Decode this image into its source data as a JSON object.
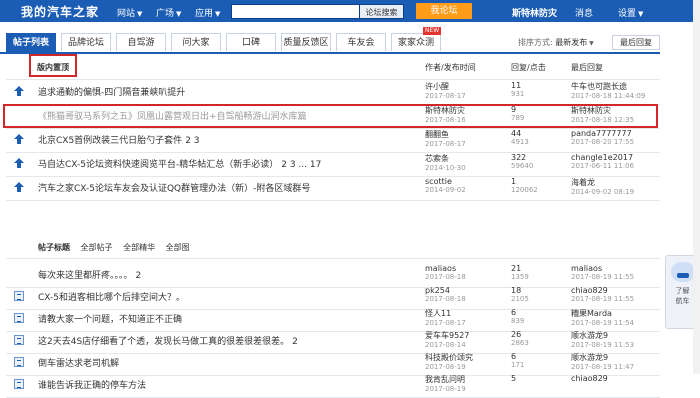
{
  "topbar": {
    "logo": "我的汽车之家",
    "nav": [
      "网站",
      "广场",
      "应用"
    ],
    "search_button": "论坛搜索",
    "post_button": "我论坛",
    "username": "斯特林防灾",
    "messages": "消息",
    "settings": "设置"
  },
  "tabs": [
    "帖子列表",
    "品牌论坛",
    "自驾游",
    "问大家",
    "口碑",
    "质量反馈区",
    "车友会",
    "家家众测"
  ],
  "new_badge": "NEW",
  "sort": {
    "label": "排序方式:",
    "value": "最新发布"
  },
  "latest_reply_button": "最后回复",
  "header": {
    "pinned_label": "版内置顶",
    "author_col": "作者/发布时间",
    "reply_col": "回复/点击",
    "last_reply_col": "最后回复"
  },
  "pinned_rows": [
    {
      "title": "追求通勤的偏惧-四门隔音兼峡叭提升",
      "pages": "",
      "author": "许小醒",
      "date": "2017-08-17",
      "replies": "11",
      "clicks": "931",
      "last_user": "牛车也可跑长途",
      "last_time": "2017-08-18 11:44:09"
    },
    {
      "title": "《熊猫哥驭马系列之五》凤凰山露营观日出+自驾船畅游山涧水库篇",
      "pages": "",
      "author": "斯特林防灾",
      "date": "2017-08-16",
      "replies": "9",
      "clicks": "789",
      "last_user": "斯特林防灾",
      "last_time": "2017-08-18 12:35"
    },
    {
      "title": "北京CX5首例改装三代日胎勺子套件",
      "pages": "2 3",
      "author": "翻翻鱼",
      "date": "2017-08-17",
      "replies": "44",
      "clicks": "4913",
      "last_user": "panda7777777",
      "last_time": "2017-08-20 17:55"
    },
    {
      "title": "马自达CX-5论坛资料快速阅览平台-精华帖汇总（新手必读）",
      "pages": "2 3 ... 17",
      "author": "芯索条",
      "date": "2014-10-30",
      "replies": "322",
      "clicks": "59640",
      "last_user": "changle1e2017",
      "last_time": "2017-06-11 11:06"
    },
    {
      "title": "汽车之家CX-5论坛车友会及认证QQ群管理办法（新）-附各区域群号",
      "pages": "",
      "author": "scottie",
      "date": "2014-09-02",
      "replies": "1",
      "clicks": "120062",
      "last_user": "海着龙",
      "last_time": "2014-09-02 08:19"
    }
  ],
  "filters": {
    "label": "帖子标题",
    "items": [
      "全部帖子",
      "全部精华",
      "全部图"
    ]
  },
  "rows": [
    {
      "title": "每次来这里都肝疼。。。。",
      "pages": "2",
      "author": "maliaos",
      "date": "2017-08-18",
      "replies": "21",
      "clicks": "1359",
      "last_user": "maliaos",
      "last_time": "2017-08-19 11:55"
    },
    {
      "title": "CX-5和逍客相比哪个后排空间大？。",
      "pages": "",
      "author": "pk254",
      "date": "2017-08-18",
      "replies": "18",
      "clicks": "2105",
      "last_user": "chiao829",
      "last_time": "2017-08-19 11:55"
    },
    {
      "title": "请教大家一个问题，不知道正不正确",
      "pages": "",
      "author": "怪人11",
      "date": "2017-08-17",
      "replies": "6",
      "clicks": "839",
      "last_user": "糟果Marda",
      "last_time": "2017-08-19 11:54"
    },
    {
      "title": "这2天去4S店仔细看了个透，发现长马做工真的很差很差很差。",
      "pages": "2",
      "author": "爱车车9527",
      "date": "2017-08-14",
      "replies": "26",
      "clicks": "2863",
      "last_user": "顺水游龙9",
      "last_time": "2017-08-19 11:53"
    },
    {
      "title": "倒车雷达求老司机解",
      "pages": "",
      "author": "科技殿价颂究",
      "date": "2017-08-19",
      "replies": "6",
      "clicks": "171",
      "last_user": "顺水游龙9",
      "last_time": "2017-08-19 11:47"
    },
    {
      "title": "谁能告诉我正确的停车方法",
      "pages": "",
      "author": "我肯乱问明",
      "date": "2017-08-19",
      "replies": "5",
      "clicks": "",
      "last_user": "chiao829",
      "last_time": ""
    }
  ],
  "widget": {
    "label1": "了解",
    "label2": "航车"
  },
  "colors": {
    "brand_blue": "#1b5cb5",
    "highlight_red": "#d0262c",
    "post_orange": "#ff9c1a"
  }
}
